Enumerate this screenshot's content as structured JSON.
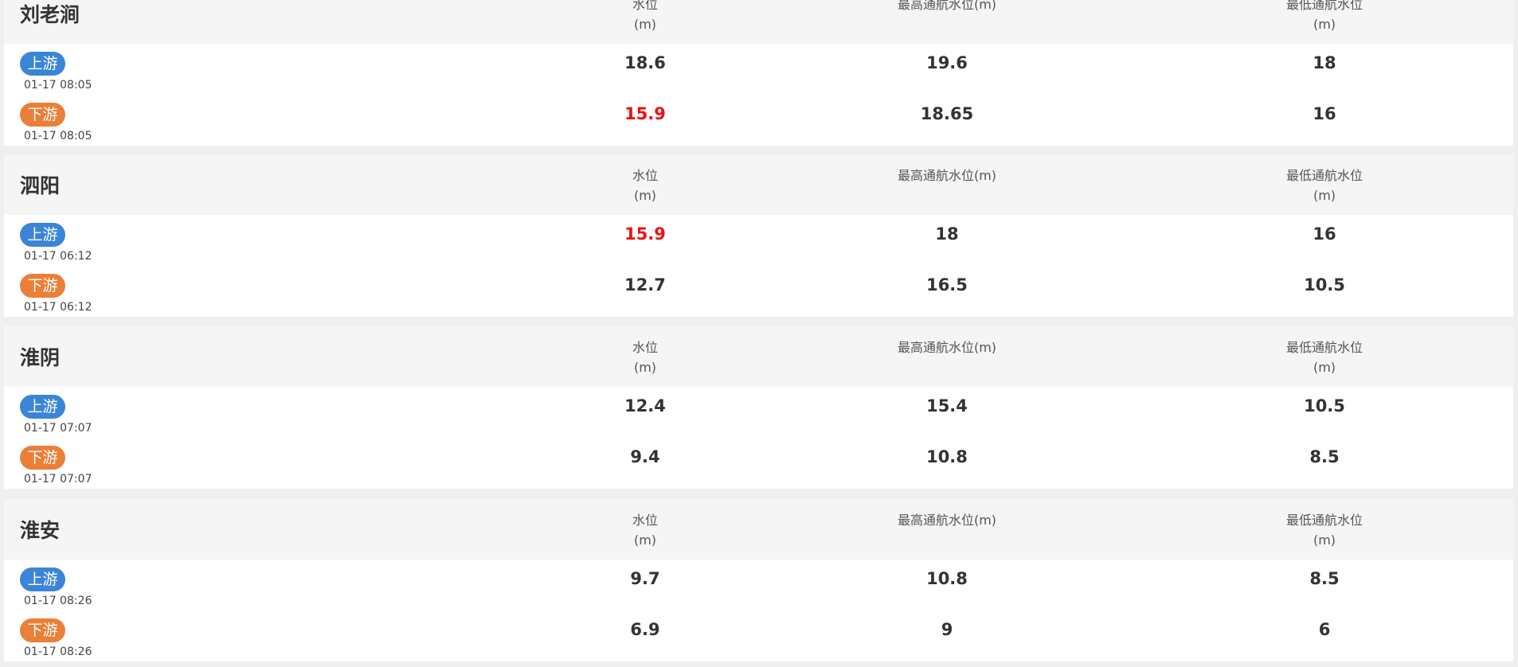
{
  "colors": {
    "upstream_badge": "#3b85d8",
    "downstream_badge": "#ec7f38",
    "alert_value": "#ee1111"
  },
  "stations": [
    {
      "name": "刘老涧",
      "headers": {
        "level": [
          "水位",
          "(m)"
        ],
        "max": [
          "最高通航水位(m)"
        ],
        "min": [
          "最低通航水位",
          "(m)"
        ]
      },
      "upstream": {
        "label": "上游",
        "time": "01-17 08:05",
        "level": "18.6",
        "max": "19.6",
        "min": "18",
        "level_alert": false
      },
      "downstream": {
        "label": "下游",
        "time": "01-17 08:05",
        "level": "15.9",
        "max": "18.65",
        "min": "16",
        "level_alert": true
      }
    },
    {
      "name": "泗阳",
      "headers": {
        "level": [
          "水位",
          "(m)"
        ],
        "max": [
          "最高通航水位(m)"
        ],
        "min": [
          "最低通航水位",
          "(m)"
        ]
      },
      "upstream": {
        "label": "上游",
        "time": "01-17 06:12",
        "level": "15.9",
        "max": "18",
        "min": "16",
        "level_alert": true
      },
      "downstream": {
        "label": "下游",
        "time": "01-17 06:12",
        "level": "12.7",
        "max": "16.5",
        "min": "10.5",
        "level_alert": false
      }
    },
    {
      "name": "淮阴",
      "headers": {
        "level": [
          "水位",
          "(m)"
        ],
        "max": [
          "最高通航水位(m)"
        ],
        "min": [
          "最低通航水位",
          "(m)"
        ]
      },
      "upstream": {
        "label": "上游",
        "time": "01-17 07:07",
        "level": "12.4",
        "max": "15.4",
        "min": "10.5",
        "level_alert": false
      },
      "downstream": {
        "label": "下游",
        "time": "01-17 07:07",
        "level": "9.4",
        "max": "10.8",
        "min": "8.5",
        "level_alert": false
      }
    },
    {
      "name": "淮安",
      "headers": {
        "level": [
          "水位",
          "(m)"
        ],
        "max": [
          "最高通航水位(m)"
        ],
        "min": [
          "最低通航水位",
          "(m)"
        ]
      },
      "upstream": {
        "label": "上游",
        "time": "01-17 08:26",
        "level": "9.7",
        "max": "10.8",
        "min": "8.5",
        "level_alert": false
      },
      "downstream": {
        "label": "下游",
        "time": "01-17 08:26",
        "level": "6.9",
        "max": "9",
        "min": "6",
        "level_alert": false
      }
    }
  ]
}
